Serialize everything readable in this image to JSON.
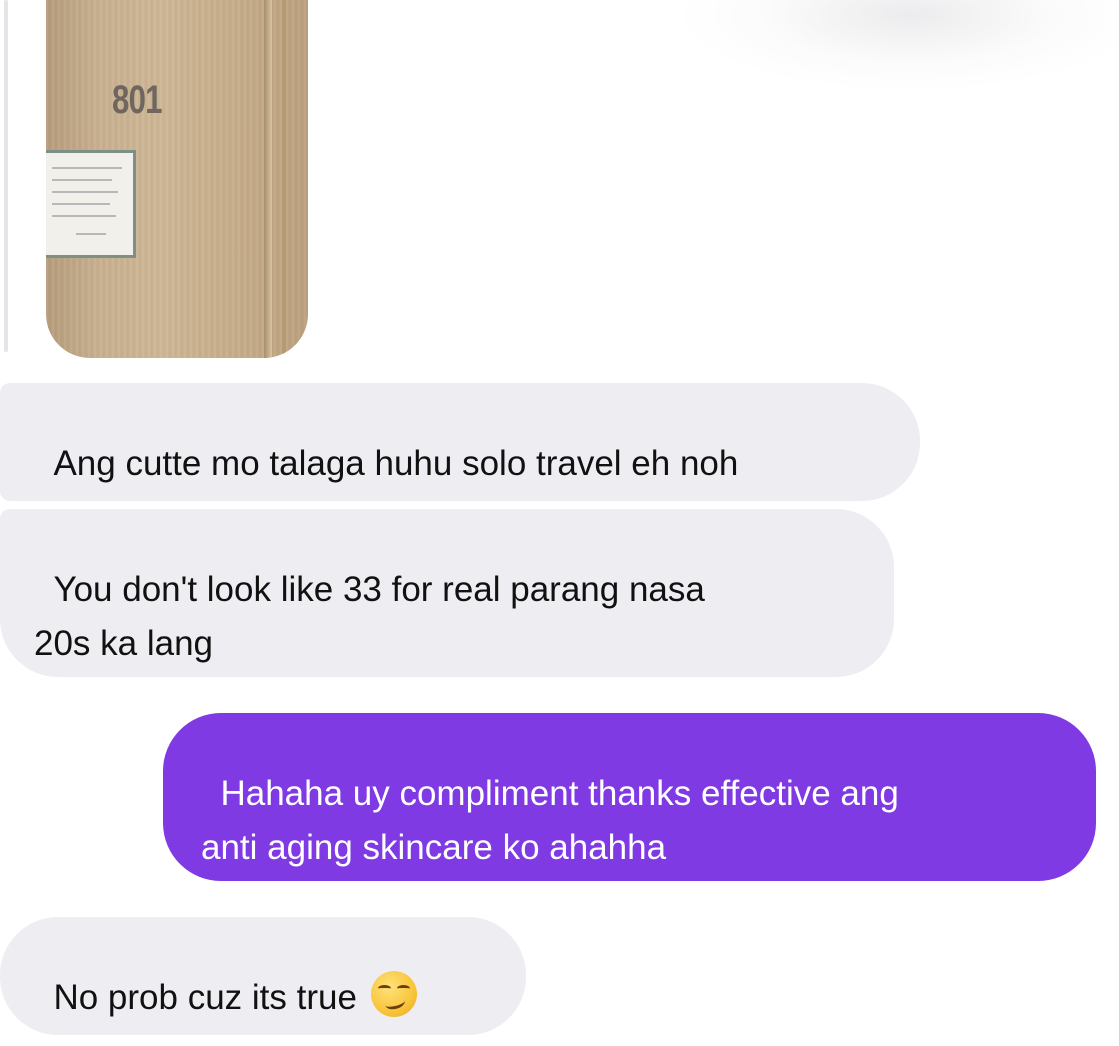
{
  "story_preview": {
    "room_number": "801",
    "media_icon": "play-icon"
  },
  "messages": [
    {
      "direction": "incoming",
      "text": "Ang cutte mo talaga huhu solo travel eh noh"
    },
    {
      "direction": "incoming",
      "text": "You don't look like 33 for real parang nasa\n20s ka lang"
    },
    {
      "direction": "outgoing",
      "text": "Hahaha uy compliment thanks effective ang\nanti aging skincare ko ahahha"
    },
    {
      "direction": "incoming",
      "text": "No prob cuz its true",
      "emoji": "smirking-face-emoji"
    }
  ],
  "colors": {
    "incoming_bubble": "#eeeef2",
    "outgoing_bubble": "#7f3ae4",
    "incoming_text": "#111111",
    "outgoing_text": "#ffffff"
  }
}
